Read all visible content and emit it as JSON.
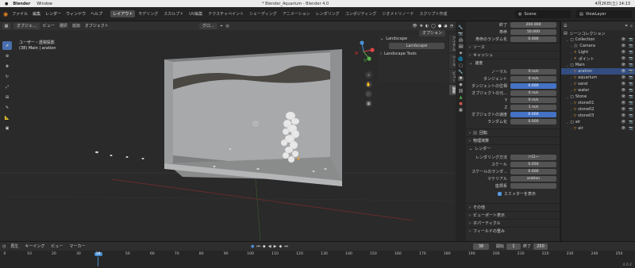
{
  "macos": {
    "app": "Blender",
    "menu": [
      "Window"
    ],
    "title": "* Blender_Aquarium - Blender 4.0",
    "clock": "4月26日(土) 14:13"
  },
  "topbar": {
    "menus": [
      "ファイル",
      "編集",
      "レンダー",
      "ウィンドウ",
      "ヘルプ"
    ],
    "workspaces": [
      "レイアウト",
      "モデリング",
      "スカルプト",
      "UV編集",
      "テクスチャペイント",
      "シェーディング",
      "アニメーション",
      "レンダリング",
      "コンポジティング",
      "ジオメトリノード",
      "スクリプト作成"
    ],
    "scene_label": "Scene",
    "viewlayer_label": "ViewLayer"
  },
  "viewport_header": {
    "mode": "オブジェ...",
    "menus": [
      "ビュー",
      "選択",
      "追加",
      "オブジェクト"
    ],
    "transform": "グロ...",
    "options": "オプション"
  },
  "viewport": {
    "view_name": "ユーザー・透視投影",
    "object_info": "(38) Main | aration"
  },
  "npanel": {
    "section_title": "Landscape",
    "landscape_button": "Landscape",
    "sub_section": "Landscape Tools",
    "tabs": [
      "アイテム",
      "ツール",
      "ビュー",
      "編集"
    ]
  },
  "properties": {
    "rows_top": [
      {
        "label": "終了",
        "value": "200.000"
      },
      {
        "label": "寿命",
        "value": "50.000"
      },
      {
        "label": "寿命のランダム化",
        "value": "0.000"
      }
    ],
    "source_section": "ソース",
    "cache_section": "キャッシュ",
    "velocity_section": "速度",
    "velocity_rows": [
      {
        "label": "ノーマル",
        "value": "0 m/s"
      },
      {
        "label": "タンジェント",
        "value": "0 m/s"
      },
      {
        "label": "タンジェントの位相",
        "value": "0.000",
        "blue": true
      },
      {
        "label": "オブジェクトの元...",
        "value": "0 m/s"
      },
      {
        "label": "Y",
        "value": "0 m/s"
      },
      {
        "label": "Z",
        "value": "1 m/s"
      },
      {
        "label": "オブジェクトの速度",
        "value": "0.000",
        "blue": true
      },
      {
        "label": "ランダム化",
        "value": "0.000"
      }
    ],
    "rotation_section": "回転",
    "physics_section": "物理演算",
    "render_section": "レンダー",
    "render_rows": [
      {
        "label": "レンダリング方法",
        "value": "ハロー"
      },
      {
        "label": "スケール",
        "value": "0.050"
      },
      {
        "label": "スケールのランダ...",
        "value": "0.000"
      },
      {
        "label": "マテリアル",
        "value": "aration"
      },
      {
        "label": "座標系",
        "value": ""
      }
    ],
    "emitter_label": "エミッターを表示",
    "other_sections": [
      "その他",
      "ビューポート表示",
      "子パーティクル",
      "フィールドの重み"
    ]
  },
  "outliner": {
    "title": "シーンコレクション",
    "items": [
      {
        "name": "Collection",
        "depth": 1,
        "kind": "collection"
      },
      {
        "name": "Camera",
        "depth": 2,
        "kind": "camera"
      },
      {
        "name": "Light",
        "depth": 2,
        "kind": "light"
      },
      {
        "name": "ポイント",
        "depth": 2,
        "kind": "light"
      },
      {
        "name": "Main",
        "depth": 1,
        "kind": "collection"
      },
      {
        "name": "aration",
        "depth": 2,
        "kind": "mesh",
        "selected": true
      },
      {
        "name": "aquarium",
        "depth": 2,
        "kind": "mesh"
      },
      {
        "name": "sand",
        "depth": 2,
        "kind": "mesh"
      },
      {
        "name": "water",
        "depth": 2,
        "kind": "mesh"
      },
      {
        "name": "Stone",
        "depth": 1,
        "kind": "collection"
      },
      {
        "name": "stone01",
        "depth": 2,
        "kind": "mesh"
      },
      {
        "name": "stone02",
        "depth": 2,
        "kind": "mesh"
      },
      {
        "name": "stone03",
        "depth": 2,
        "kind": "mesh"
      },
      {
        "name": "air",
        "depth": 1,
        "kind": "collection"
      },
      {
        "name": "air",
        "depth": 2,
        "kind": "mesh"
      }
    ]
  },
  "timeline": {
    "menus": [
      "再生",
      "キーイング",
      "ビュー",
      "マーカー"
    ],
    "current_frame": "38",
    "start_label": "開始",
    "start": "1",
    "end_label": "終了",
    "end": "250",
    "ruler": [
      "0",
      "10",
      "20",
      "30",
      "38",
      "50",
      "60",
      "70",
      "80",
      "90",
      "100",
      "110",
      "120",
      "130",
      "140",
      "150",
      "160",
      "170",
      "180",
      "190",
      "200",
      "210",
      "220",
      "230",
      "240",
      "250"
    ],
    "version": "4.0.2"
  },
  "colors": {
    "accent_blue": "#4472c4",
    "active_workspace": "#4a4a4a",
    "selected_row": "#334d80",
    "playhead": "#4a8fd4"
  }
}
